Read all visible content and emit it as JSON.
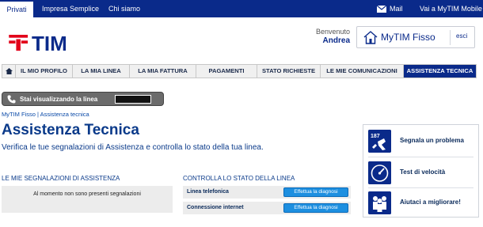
{
  "topbar": {
    "tabs": [
      "Privati",
      "Impresa Semplice",
      "Chi siamo"
    ],
    "mail": "Mail",
    "mytim_mobile": "Vai a MyTIM Mobile"
  },
  "header": {
    "logo": "TIM",
    "welcome": "Benvenuto",
    "user": "Andrea",
    "mytim_fisso": "MyTIM Fisso",
    "logout": "esci"
  },
  "nav": {
    "items": [
      "IL MIO PROFILO",
      "LA MIA LINEA",
      "LA MIA FATTURA",
      "PAGAMENTI",
      "STATO RICHIESTE",
      "LE MIE COMUNICAZIONI",
      "ASSISTENZA TECNICA"
    ],
    "active": "ASSISTENZA TECNICA"
  },
  "line_view": {
    "label": "Stai visualizzando la linea"
  },
  "breadcrumb": "MyTIM Fisso | Assistenza tecnica",
  "page": {
    "title": "Assistenza Tecnica",
    "subtitle": "Verifica le tue segnalazioni di Assistenza e controlla lo stato della tua linea."
  },
  "reports": {
    "heading": "LE MIE SEGNALAZIONI DI ASSISTENZA",
    "empty_message": "Al momento non sono presenti segnalazioni"
  },
  "line_status": {
    "heading": "CONTROLLA LO STATO DELLA LINEA",
    "rows": [
      {
        "label": "Linea telefonica",
        "button": "Effettua la diagnosi"
      },
      {
        "label": "Connessione internet",
        "button": "Effettua la diagnosi"
      }
    ]
  },
  "side": {
    "items": [
      {
        "label": "Segnala un problema",
        "icon": "report-problem-icon"
      },
      {
        "label": "Test di velocità",
        "icon": "speedometer-icon"
      },
      {
        "label": "Aiutaci a migliorare!",
        "icon": "people-icon"
      }
    ]
  },
  "colors": {
    "brand": "#0a2a8a",
    "button": "#1d8fe0",
    "logo_red": "#e2001a"
  }
}
